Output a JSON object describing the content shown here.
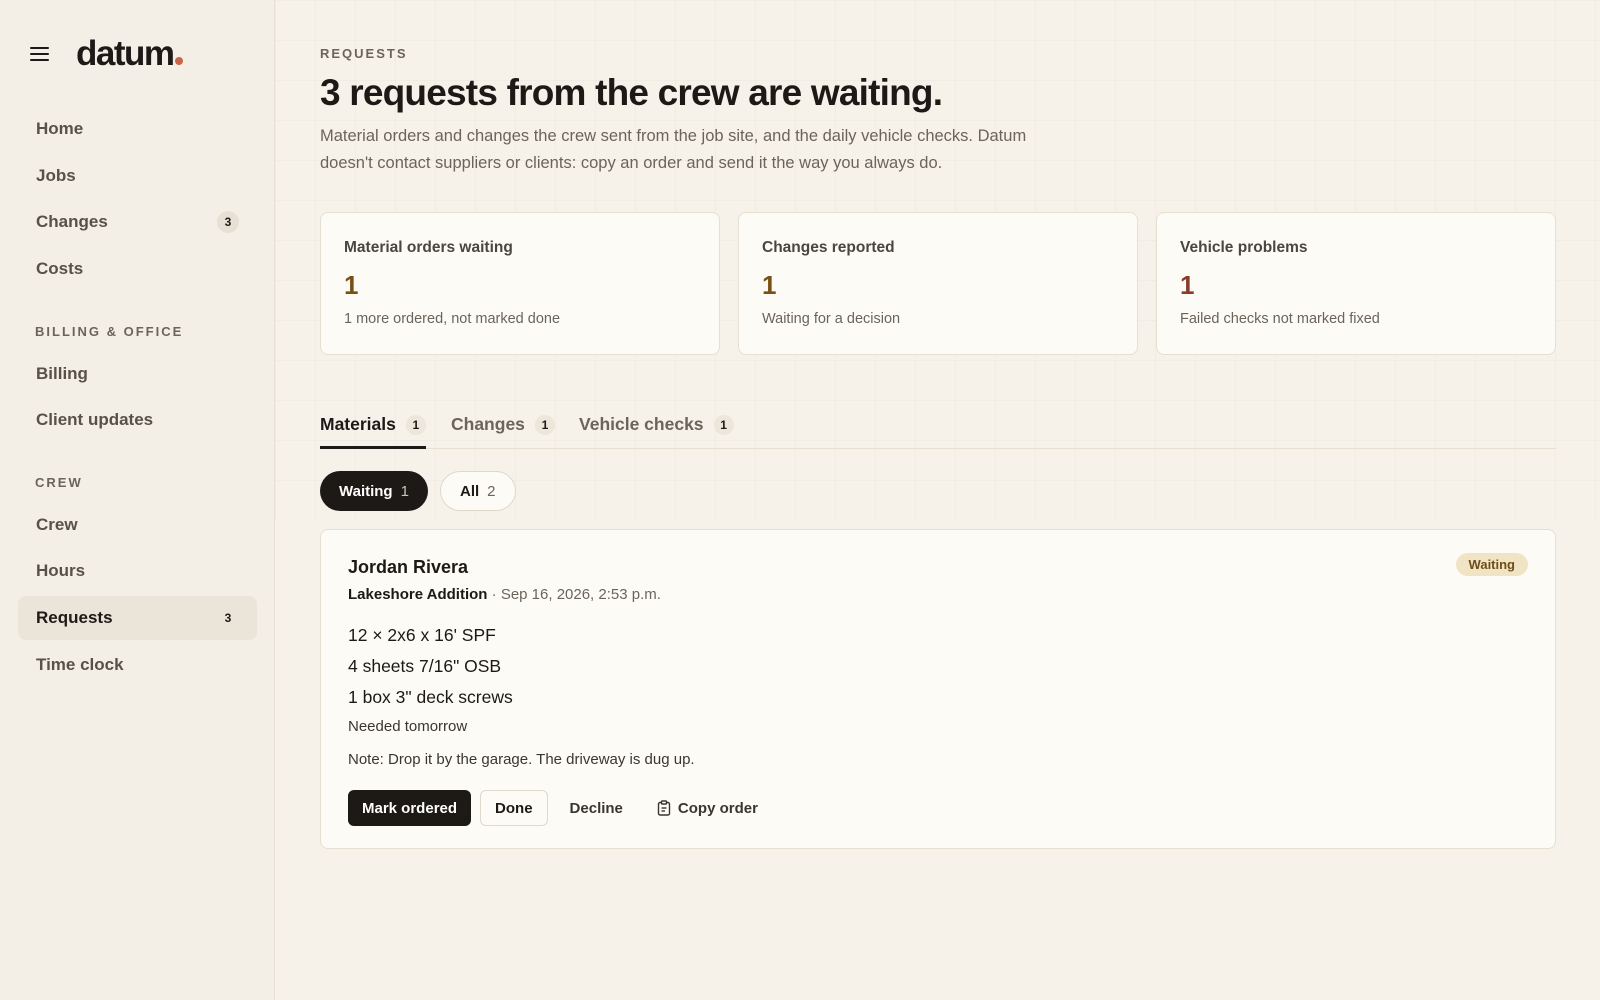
{
  "brand": {
    "name": "datum",
    "dot_color": "#c8664a"
  },
  "sidebar": {
    "items": [
      {
        "label": "Home",
        "badge": null
      },
      {
        "label": "Jobs",
        "badge": null
      },
      {
        "label": "Changes",
        "badge": "3"
      },
      {
        "label": "Costs",
        "badge": null
      }
    ],
    "billing_section": "BILLING & OFFICE",
    "billing_items": [
      {
        "label": "Billing"
      },
      {
        "label": "Client updates"
      }
    ],
    "crew_section": "CREW",
    "crew_items": [
      {
        "label": "Crew",
        "badge": null
      },
      {
        "label": "Hours",
        "badge": null
      },
      {
        "label": "Requests",
        "badge": "3",
        "active": true
      },
      {
        "label": "Time clock",
        "badge": null
      }
    ]
  },
  "header": {
    "eyebrow": "REQUESTS",
    "title": "3 requests from the crew are waiting.",
    "description": "Material orders and changes the crew sent from the job site, and the daily vehicle checks. Datum doesn't contact suppliers or clients: copy an order and send it the way you always do."
  },
  "stats": [
    {
      "label": "Material orders waiting",
      "value": "1",
      "sub": "1 more ordered, not marked done"
    },
    {
      "label": "Changes reported",
      "value": "1",
      "sub": "Waiting for a decision"
    },
    {
      "label": "Vehicle problems",
      "value": "1",
      "sub": "Failed checks not marked fixed"
    }
  ],
  "tabs": [
    {
      "label": "Materials",
      "count": "1",
      "active": true
    },
    {
      "label": "Changes",
      "count": "1"
    },
    {
      "label": "Vehicle checks",
      "count": "1"
    }
  ],
  "filters": [
    {
      "label": "Waiting",
      "count": "1",
      "active": true
    },
    {
      "label": "All",
      "count": "2"
    }
  ],
  "request": {
    "name": "Jordan Rivera",
    "job": "Lakeshore Addition",
    "separator": " · ",
    "date": "Sep 16, 2026, 2:53 p.m.",
    "status": "Waiting",
    "items": [
      "12 × 2x6 x 16' SPF",
      "4 sheets 7/16\" OSB",
      "1 box 3\" deck screws"
    ],
    "needed": "Needed tomorrow",
    "note": "Note: Drop it by the garage. The driveway is dug up.",
    "actions": {
      "mark_ordered": "Mark ordered",
      "done": "Done",
      "decline": "Decline",
      "copy_order": "Copy order"
    }
  }
}
